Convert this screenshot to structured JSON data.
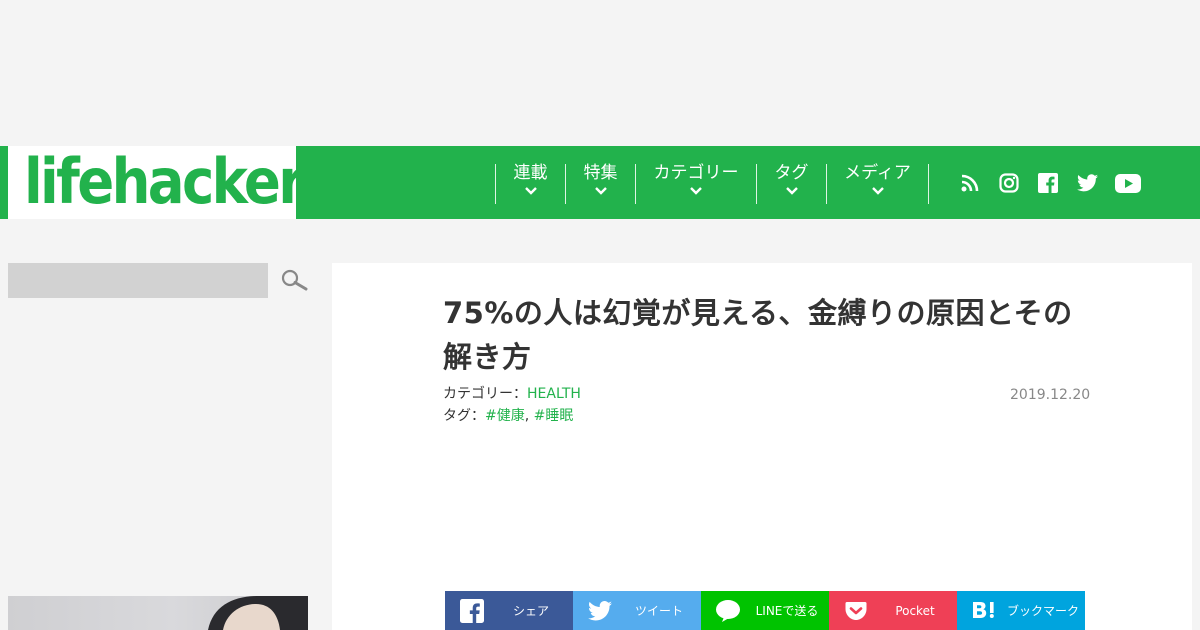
{
  "header": {
    "logo_text": "lifehacker",
    "nav": [
      {
        "label": "連載"
      },
      {
        "label": "特集"
      },
      {
        "label": "カテゴリー"
      },
      {
        "label": "タグ"
      },
      {
        "label": "メディア"
      }
    ],
    "social_icons": [
      "rss-icon",
      "instagram-icon",
      "facebook-icon",
      "twitter-icon",
      "youtube-icon"
    ]
  },
  "sidebar": {
    "search_value": "",
    "search_icon": "search-icon"
  },
  "article": {
    "title": "75%の人は幻覚が見える、金縛りの原因とその解き方",
    "category_label": "カテゴリー：",
    "category_value": "HEALTH",
    "tag_label": "タグ：",
    "tags": [
      "#健康",
      "#睡眠"
    ],
    "tag_separator": ",",
    "date": "2019.12.20"
  },
  "share": [
    {
      "label": "シェア",
      "icon": "facebook-icon",
      "color": "#3b5998"
    },
    {
      "label": "ツイート",
      "icon": "twitter-icon",
      "color": "#55acee"
    },
    {
      "label": "LINEで送る",
      "icon": "line-icon",
      "color": "#00c300"
    },
    {
      "label": "Pocket",
      "icon": "pocket-icon",
      "color": "#ef4056"
    },
    {
      "label": "ブックマーク",
      "icon": "hatena-bookmark-icon",
      "color": "#00a4de"
    }
  ],
  "colors": {
    "brand_green": "#22b24c",
    "background": "#f4f4f4"
  }
}
